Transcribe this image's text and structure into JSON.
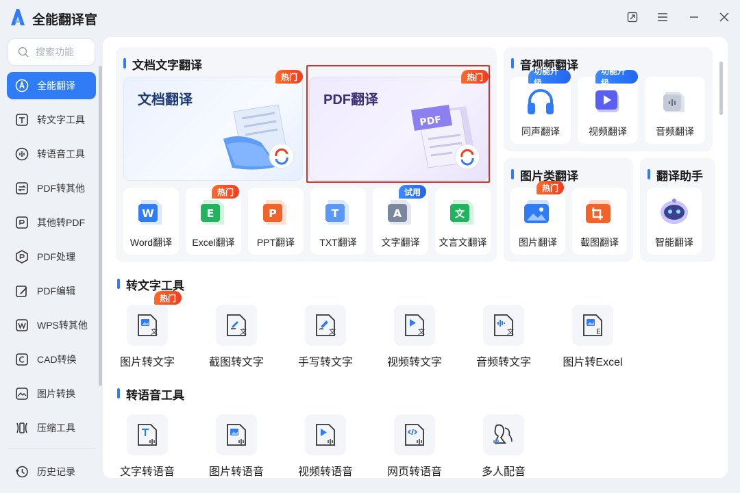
{
  "app": {
    "title": "全能翻译官"
  },
  "search": {
    "placeholder": "搜索功能"
  },
  "sidebar": {
    "items": [
      {
        "label": "全能翻译",
        "icon": "translate-icon",
        "active": true
      },
      {
        "label": "转文字工具",
        "icon": "text-tool-icon"
      },
      {
        "label": "转语音工具",
        "icon": "voice-tool-icon"
      },
      {
        "label": "PDF转其他",
        "icon": "pdf-convert-icon"
      },
      {
        "label": "其他转PDF",
        "icon": "to-pdf-icon"
      },
      {
        "label": "PDF处理",
        "icon": "pdf-process-icon"
      },
      {
        "label": "PDF编辑",
        "icon": "pdf-edit-icon"
      },
      {
        "label": "WPS转其他",
        "icon": "wps-icon"
      },
      {
        "label": "CAD转换",
        "icon": "cad-icon"
      },
      {
        "label": "图片转换",
        "icon": "image-convert-icon"
      },
      {
        "label": "压缩工具",
        "icon": "compress-icon"
      }
    ],
    "history": "历史记录"
  },
  "doc_section": {
    "title": "文档文字翻译",
    "big_cards": [
      {
        "label": "文档翻译",
        "badge": "热门"
      },
      {
        "label": "PDF翻译",
        "badge": "热门",
        "pdf_art": "PDF"
      }
    ],
    "tiles": [
      {
        "label": "Word翻译",
        "glyph": "W",
        "color": "#2f7cf6"
      },
      {
        "label": "Excel翻译",
        "glyph": "E",
        "color": "#22b35e",
        "badge": "热门"
      },
      {
        "label": "PPT翻译",
        "glyph": "P",
        "color": "#f2632a"
      },
      {
        "label": "TXT翻译",
        "glyph": "T",
        "color": "#3b82f6"
      },
      {
        "label": "文字翻译",
        "glyph": "A",
        "color": "#5b6b86",
        "badge": "试用"
      },
      {
        "label": "文言文翻译",
        "glyph": "文",
        "color": "#22b35e"
      }
    ]
  },
  "av_section": {
    "title": "音视频翻译",
    "tiles": [
      {
        "label": "同声翻译",
        "badge": "功能升级"
      },
      {
        "label": "视频翻译",
        "badge": "功能升级"
      },
      {
        "label": "音频翻译"
      }
    ]
  },
  "img_section": {
    "title": "图片类翻译",
    "tiles": [
      {
        "label": "图片翻译",
        "badge": "热门"
      },
      {
        "label": "截图翻译"
      }
    ]
  },
  "assist_section": {
    "title": "翻译助手",
    "tiles": [
      {
        "label": "智能翻译"
      }
    ]
  },
  "ocr_section": {
    "title": "转文字工具",
    "tools": [
      {
        "label": "图片转文字",
        "badge": "热门",
        "icon": "image-to-text-icon"
      },
      {
        "label": "截图转文字",
        "icon": "screenshot-to-text-icon"
      },
      {
        "label": "手写转文字",
        "icon": "handwriting-to-text-icon"
      },
      {
        "label": "视频转文字",
        "icon": "video-to-text-icon"
      },
      {
        "label": "音频转文字",
        "icon": "audio-to-text-icon"
      },
      {
        "label": "图片转Excel",
        "icon": "image-to-excel-icon"
      }
    ]
  },
  "tts_section": {
    "title": "转语音工具",
    "tools": [
      {
        "label": "文字转语音",
        "icon": "text-to-speech-icon"
      },
      {
        "label": "图片转语音",
        "icon": "image-to-speech-icon"
      },
      {
        "label": "视频转语音",
        "icon": "video-to-speech-icon"
      },
      {
        "label": "网页转语音",
        "icon": "webpage-to-speech-icon"
      },
      {
        "label": "多人配音",
        "icon": "multi-voice-icon"
      }
    ]
  },
  "colors": {
    "accent": "#2f7cf6",
    "hot": "#f23d1d",
    "highlight_border": "#d9302c"
  }
}
